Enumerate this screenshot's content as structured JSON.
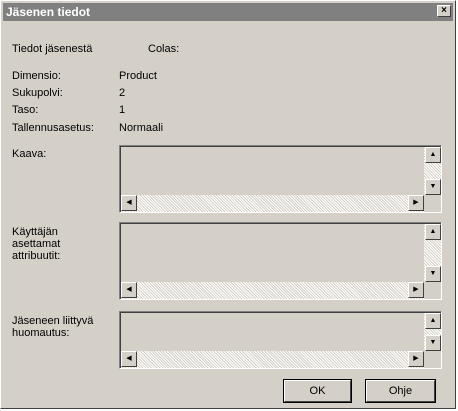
{
  "window": {
    "title": "Jäsenen tiedot",
    "close_symbol": "×"
  },
  "header": {
    "info_label": "Tiedot jäsenestä",
    "member_name": "Colas:"
  },
  "properties": {
    "dimension_label": "Dimensio:",
    "dimension_value": "Product",
    "generation_label": "Sukupolvi:",
    "generation_value": "2",
    "level_label": "Taso:",
    "level_value": "1",
    "storage_label": "Tallennusasetus:",
    "storage_value": "Normaali"
  },
  "fields": {
    "formula_label": "Kaava:",
    "udas_label": "Käyttäjän\nasettamat\nattribuutit:",
    "comment_label": "Jäseneen liittyvä\nhuomautus:",
    "formula_value": "",
    "udas_value": "",
    "comment_value": ""
  },
  "icons": {
    "scroll_up": "▲",
    "scroll_down": "▼",
    "scroll_left": "◀",
    "scroll_right": "▶"
  },
  "buttons": {
    "ok_label": "OK",
    "help_label": "Ohje"
  }
}
